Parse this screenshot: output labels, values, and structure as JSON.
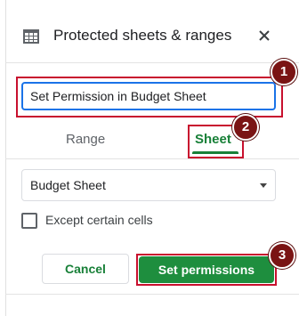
{
  "header": {
    "title": "Protected sheets & ranges",
    "icon": "table-icon",
    "close_icon": "close-icon"
  },
  "description_input": {
    "value": "Set Permission in Budget Sheet"
  },
  "tabs": [
    {
      "label": "Range",
      "active": false
    },
    {
      "label": "Sheet",
      "active": true
    }
  ],
  "sheet_select": {
    "selected": "Budget Sheet"
  },
  "except_checkbox": {
    "label": "Except certain cells",
    "checked": false
  },
  "buttons": {
    "cancel": "Cancel",
    "set_permissions": "Set permissions"
  },
  "annotations": {
    "badge1": "1",
    "badge2": "2",
    "badge3": "3"
  },
  "colors": {
    "accent_green": "#188038",
    "button_green": "#1e8e3e",
    "focus_blue": "#1a73e8",
    "highlight_red": "#c8102e",
    "badge_bg": "#7a1414"
  }
}
